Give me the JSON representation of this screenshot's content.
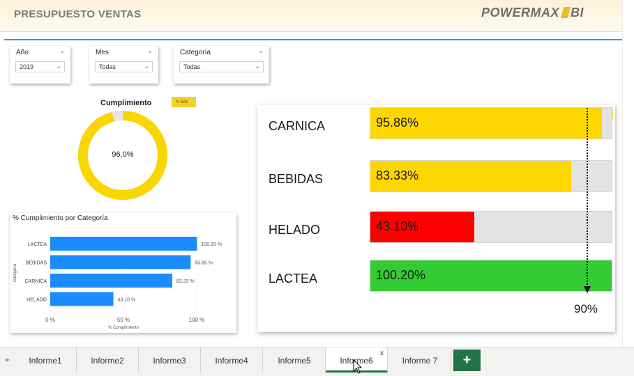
{
  "header": {
    "title": "PRESUPUESTO VENTAS",
    "logo_text": "POWERMAX",
    "logo_suffix": "BI"
  },
  "slicers": [
    {
      "label": "Año",
      "value": "2019"
    },
    {
      "label": "Mes",
      "value": "Todas"
    },
    {
      "label": "Categoría",
      "value": "Todas"
    }
  ],
  "gauge": {
    "title": "Cumplimiento",
    "value_text": "96.0%",
    "value": 96.0,
    "color": "#f9d600",
    "track_color": "#e6e6e6"
  },
  "edit_label": "Edit",
  "chart_data": {
    "type": "bar",
    "title": "% Cumplimiento por Categoría",
    "ylabel": "Categoría",
    "xlabel": "% Cumplimiento",
    "categories": [
      "LACTEA",
      "BEBIDAS",
      "CARNICA",
      "HELADO"
    ],
    "values": [
      100.2,
      95.86,
      83.33,
      43.1
    ],
    "value_labels": [
      "100.20 %",
      "95.86 %",
      "83.33 %",
      "43.10 %"
    ],
    "x_ticks": [
      "0 %",
      "50 %",
      "100 %"
    ],
    "xlim": [
      0,
      100
    ],
    "bar_color": "#1a8cff",
    "grid": true
  },
  "kpi_bars": {
    "items": [
      {
        "category": "CARNICA",
        "value_text": "95.86%",
        "value": 95.86,
        "color": "#ffd700"
      },
      {
        "category": "BEBIDAS",
        "value_text": "83.33%",
        "value": 83.33,
        "color": "#ffd700"
      },
      {
        "category": "HELADO",
        "value_text": "43.10%",
        "value": 43.1,
        "color": "#ff0000"
      },
      {
        "category": "LACTEA",
        "value_text": "100.20%",
        "value": 100.2,
        "color": "#33cc33"
      }
    ],
    "target_text": "90%",
    "target": 90
  },
  "tabs": [
    {
      "label": "Informe1",
      "active": false
    },
    {
      "label": "Informe2",
      "active": false
    },
    {
      "label": "Informe3",
      "active": false
    },
    {
      "label": "Informe4",
      "active": false
    },
    {
      "label": "Informe5",
      "active": false
    },
    {
      "label": "Informe6",
      "active": true
    },
    {
      "label": "Informe 7",
      "active": false
    }
  ],
  "tab_close": "x",
  "add_tab": "+"
}
